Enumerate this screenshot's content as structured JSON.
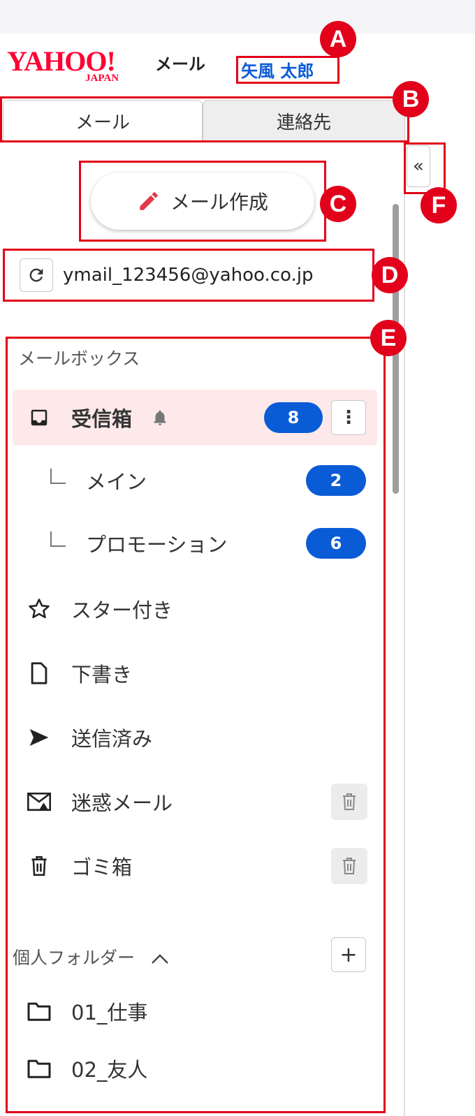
{
  "header": {
    "logo_main": "YAHOO!",
    "logo_sub": "JAPAN",
    "app_name": "メール",
    "user_name": "矢風 太郎"
  },
  "tabs": [
    {
      "label": "メール",
      "active": true
    },
    {
      "label": "連絡先",
      "active": false
    }
  ],
  "collapse_glyph": "«",
  "compose": {
    "label": "メール作成",
    "icon": "pencil-icon"
  },
  "account": {
    "email": "ymail_123456@yahoo.co.jp",
    "icon": "refresh-icon"
  },
  "mailbox": {
    "section_label": "メールボックス",
    "inbox": {
      "label": "受信箱",
      "count": "8",
      "menu": "⋮"
    },
    "sub_folders": [
      {
        "label": "メイン",
        "count": "2"
      },
      {
        "label": "プロモーション",
        "count": "6"
      }
    ],
    "items": [
      {
        "label": "スター付き",
        "icon": "star-icon"
      },
      {
        "label": "下書き",
        "icon": "draft-icon"
      },
      {
        "label": "送信済み",
        "icon": "send-icon"
      },
      {
        "label": "迷惑メール",
        "icon": "spam-icon"
      },
      {
        "label": "ゴミ箱",
        "icon": "trash-icon"
      }
    ]
  },
  "personal": {
    "section_label": "個人フォルダー",
    "folders": [
      {
        "label": "01_仕事"
      },
      {
        "label": "02_友人"
      }
    ]
  },
  "annotations": [
    "A",
    "B",
    "C",
    "D",
    "E",
    "F"
  ],
  "colors": {
    "brand_red": "#ff0033",
    "accent_blue": "#0a5bd6",
    "annotation_red": "#e2001a",
    "active_bg": "#fde8ea"
  }
}
